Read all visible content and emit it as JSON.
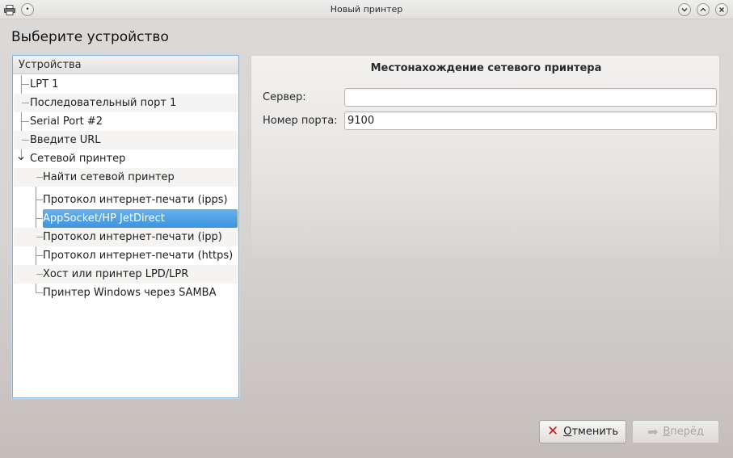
{
  "window": {
    "title": "Новый принтер",
    "app_icon": "printer-icon",
    "controls": [
      "minimize-icon",
      "maximize-icon",
      "close-icon"
    ]
  },
  "heading": "Выберите устройство",
  "tree": {
    "header": "Устройства",
    "items": [
      {
        "label": "LPT 1",
        "level": 0
      },
      {
        "label": "Последовательный порт 1",
        "level": 0
      },
      {
        "label": "Serial Port #2",
        "level": 0
      },
      {
        "label": "Введите URL",
        "level": 0
      },
      {
        "label": "Сетевой принтер",
        "level": 0,
        "expanded": true
      },
      {
        "label": "Найти сетевой принтер",
        "level": 1
      },
      {
        "label": "Протокол интернет-печати (ipps)",
        "level": 1
      },
      {
        "label": "AppSocket/HP JetDirect",
        "level": 1,
        "selected": true
      },
      {
        "label": "Протокол интернет-печати (ipp)",
        "level": 1
      },
      {
        "label": "Протокол интернет-печати (https)",
        "level": 1
      },
      {
        "label": "Хост или принтер LPD/LPR",
        "level": 1
      },
      {
        "label": "Принтер Windows через SAMBA",
        "level": 1
      }
    ]
  },
  "panel": {
    "title": "Местонахождение сетевого принтера",
    "server_label": "Сервер:",
    "server_value": "",
    "port_label": "Номер порта:",
    "port_value": "9100"
  },
  "buttons": {
    "cancel_label_mnemonic": "О",
    "cancel_label_rest": "тменить",
    "cancel_icon": "cancel-x-icon",
    "forward_label_mnemonic": "В",
    "forward_label_rest": "перёд",
    "forward_icon": "forward-arrow-icon",
    "forward_enabled": false
  },
  "colors": {
    "selection": "#3d94e0",
    "focus_border": "#7fb1dd",
    "cancel_icon": "#d01818"
  }
}
